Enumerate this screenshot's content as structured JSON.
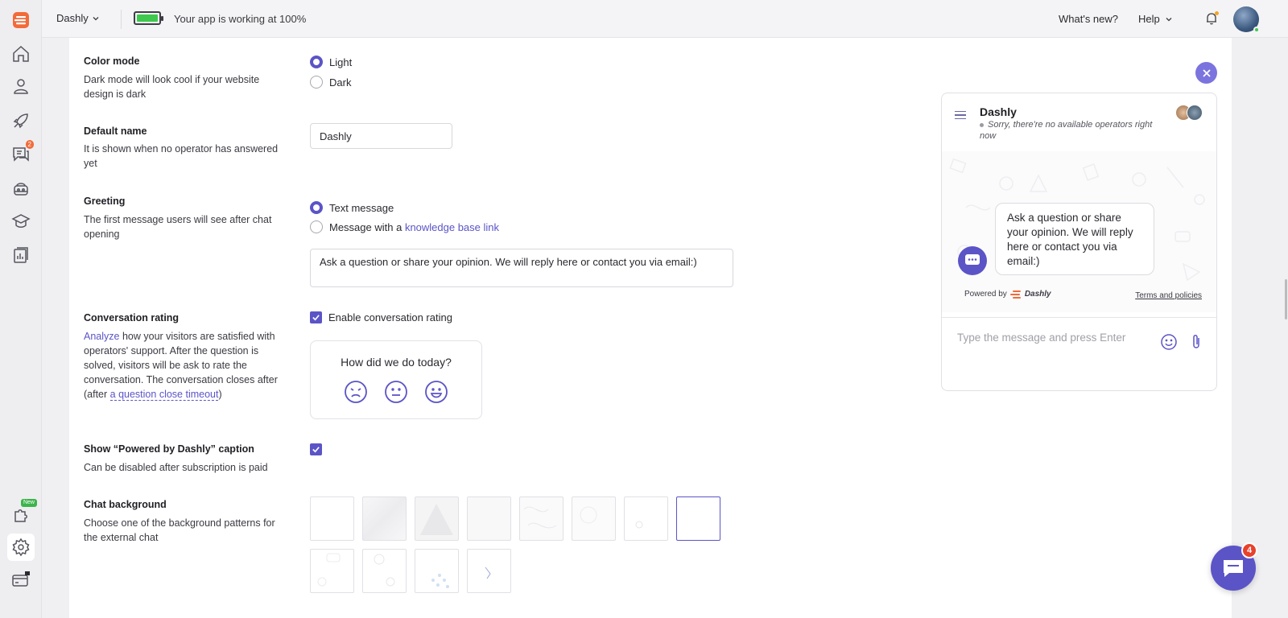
{
  "app": {
    "project_name": "Dashly",
    "status_text": "Your app is working at 100%",
    "battery_level": 1.0,
    "whats_new": "What's new?",
    "help": "Help"
  },
  "sidebar": {
    "items": [
      {
        "name": "home-icon"
      },
      {
        "name": "users-icon"
      },
      {
        "name": "rocket-icon"
      },
      {
        "name": "conversations-icon",
        "badge": "2"
      },
      {
        "name": "bot-icon"
      },
      {
        "name": "academy-icon"
      },
      {
        "name": "reports-icon"
      }
    ],
    "bottom": [
      {
        "name": "integrations-icon",
        "badge": "New"
      },
      {
        "name": "settings-icon"
      },
      {
        "name": "billing-icon"
      }
    ]
  },
  "settings": {
    "color_mode": {
      "title": "Color mode",
      "desc": "Dark mode will look cool if your website design is dark",
      "options": [
        "Light",
        "Dark"
      ],
      "selected": "Light"
    },
    "default_name": {
      "title": "Default name",
      "desc": "It is shown when no operator has answered yet",
      "value": "Dashly"
    },
    "greeting": {
      "title": "Greeting",
      "desc": "The first message users will see after chat opening",
      "option1": "Text message",
      "option2_prefix": "Message with a ",
      "option2_link": "knowledge base link",
      "message": "Ask a question or share your opinion. We will reply here or contact you via email:)"
    },
    "rating": {
      "title": "Conversation rating",
      "desc_link": "Analyze",
      "desc_text": " how your visitors are satisfied with operators' support. After the question is solved, visitors will be ask to rate the conversation. The conversation closes after (after ",
      "desc_link2": "a question close timeout",
      "desc_end": ")",
      "checkbox_label": "Enable conversation rating",
      "card_question": "How did we do today?"
    },
    "powered": {
      "title": "Show “Powered by Dashly” caption",
      "desc": "Can be disabled after subscription is paid"
    },
    "background": {
      "title": "Chat background",
      "desc": "Choose one of the background patterns for the external chat"
    }
  },
  "chat_preview": {
    "name": "Dashly",
    "status": "Sorry, there're no available operators right now",
    "message": "Ask a question or share your opinion. We will reply here or contact you via email:)",
    "powered_by": "Powered by",
    "brand": "Dashly",
    "terms": "Terms and policies",
    "composer_placeholder": "Type the message and press Enter"
  },
  "fab": {
    "count": "4"
  },
  "colors": {
    "accent": "#5b54c7",
    "brand_orange": "#f26b3a",
    "battery_green": "#3fc84e"
  }
}
